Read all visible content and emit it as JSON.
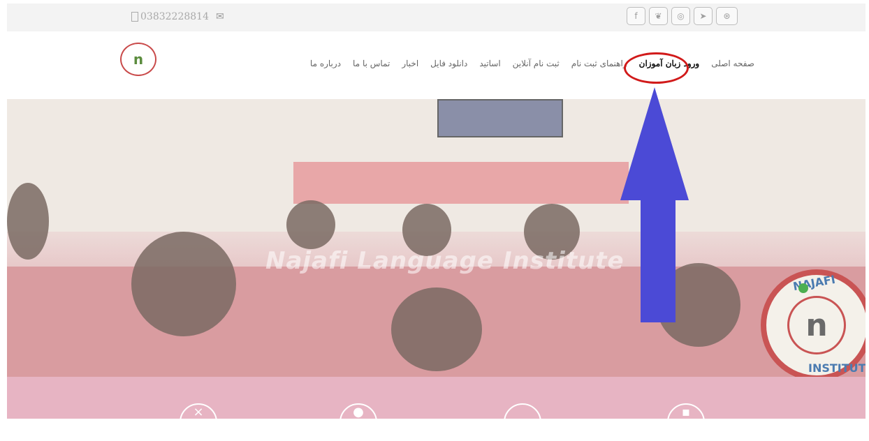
{
  "topbar": {
    "phone": "03832228814",
    "social_icons": [
      "facebook-icon",
      "twitter-icon",
      "instagram-icon",
      "telegram-icon",
      "dribbble-icon"
    ]
  },
  "nav": {
    "items": [
      {
        "label": "صفحه اصلی"
      },
      {
        "label": "ورود زبان آموزان",
        "active": true
      },
      {
        "label": "راهنمای ثبت نام"
      },
      {
        "label": "ثبت نام آنلاین"
      },
      {
        "label": "اساتید"
      },
      {
        "label": "دانلود فایل"
      },
      {
        "label": "اخبار"
      },
      {
        "label": "تماس با ما"
      },
      {
        "label": "درباره ما"
      }
    ]
  },
  "hero": {
    "watermark": "Najafi Language Institute",
    "logo_top": "NAJAFI",
    "logo_bottom": "INSTITUTE"
  },
  "colors": {
    "arrow": "#4b4ad6",
    "highlight": "#d11a1a",
    "bottom_band": "#e7b4c3"
  }
}
